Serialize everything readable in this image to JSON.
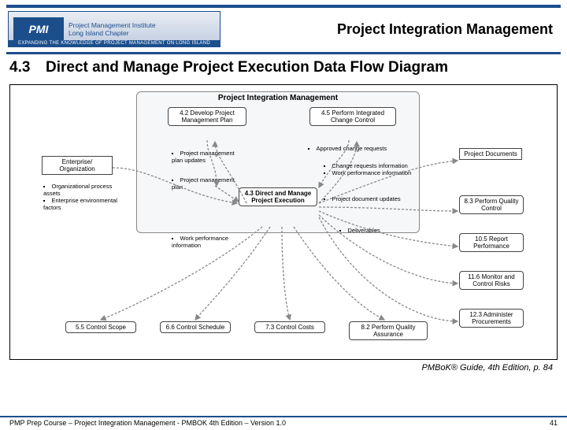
{
  "header": {
    "logo_abbr": "PMI",
    "logo_line1": "Project Management Institute",
    "logo_line2": "Long Island Chapter",
    "expanding": "EXPANDING THE KNOWLEDGE OF PROJECT MANAGEMENT ON LONG ISLAND",
    "page_title": "Project Integration Management"
  },
  "section": {
    "number": "4.3",
    "title": "Direct and Manage Project Execution Data Flow Diagram"
  },
  "diagram": {
    "group_title": "Project Integration Management",
    "nodes": {
      "n42": "4.2\nDevelop Project\nManagement\nPlan",
      "n45": "4.5\nPerform\nIntegrated Change\nControl",
      "n43": "4.3\nDirect and\nManage Project\nExecution",
      "ent": "Enterprise/\nOrganization",
      "docs": "Project\nDocuments",
      "n83": "8.3\nPerform\nQuality Control",
      "n105": "10.5\nReport\nPerformance",
      "n116": "11.6\nMonitor and\nControl Risks",
      "n123": "12.3\nAdminister\nProcurements",
      "n55": "5.5\nControl Scope",
      "n66": "6.6\nControl Schedule",
      "n73": "7.3\nControl Costs",
      "n82": "8.2\nPerform Quality\nAssurance"
    },
    "flows": {
      "f_ent": [
        "Organizational process assets",
        "Enterprise environmental factors"
      ],
      "f_pmp_up": [
        "Project management plan updates"
      ],
      "f_pmp": [
        "Project management plan"
      ],
      "f_acr": [
        "Approved change requests"
      ],
      "f_cri": [
        "Change requests information",
        "Work performance information"
      ],
      "f_pdu": [
        "Project document updates"
      ],
      "f_wpi": [
        "Work performance information"
      ],
      "f_del": [
        "Deliverables"
      ]
    }
  },
  "citation": "PMBoK® Guide, 4th Edition, p. 84",
  "footer": {
    "left": "PMP Prep Course – Project Integration Management - PMBOK 4th Edition – Version 1.0",
    "right": "41"
  }
}
